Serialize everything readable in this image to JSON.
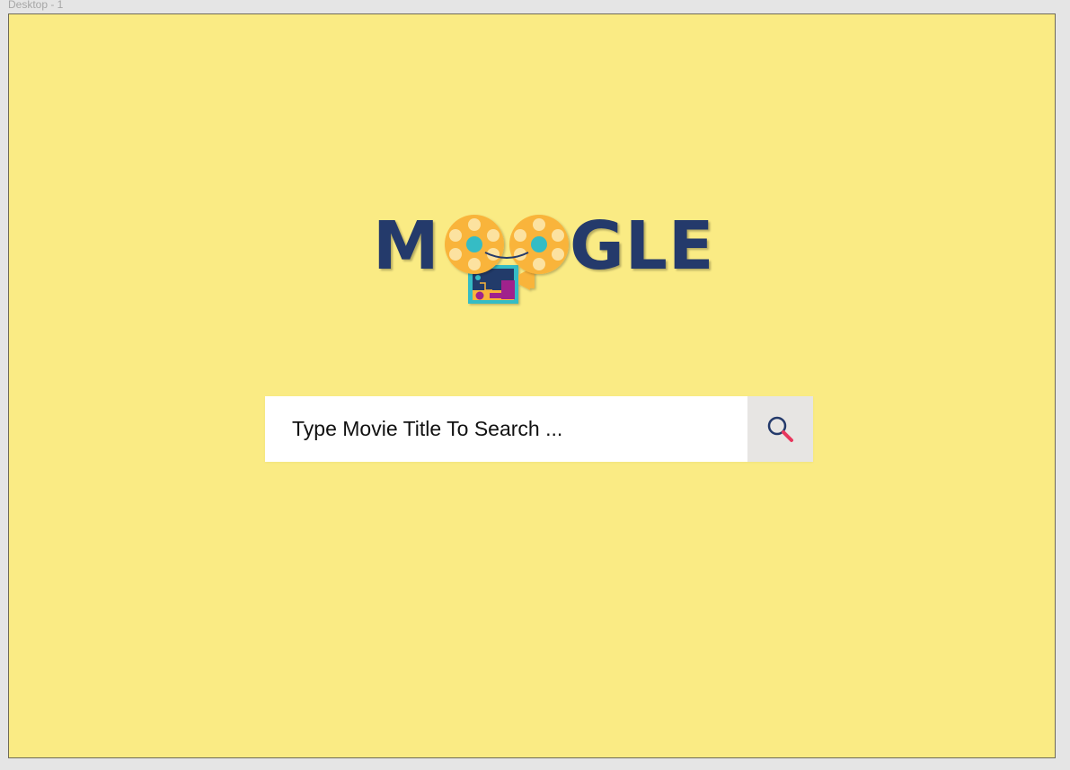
{
  "page": {
    "artboard_label": "Desktop - 1",
    "background_color": "#faeb84"
  },
  "logo": {
    "brand_name": "MOOGLE",
    "letter_m": "M",
    "letters_gle": "GLE",
    "text_color": "#243a6b",
    "reel_color": "#f9b43a",
    "accent_teal": "#35bcc5",
    "accent_purple": "#a0208c",
    "icon": "film-projector-icon"
  },
  "search": {
    "placeholder": "Type Movie Title To Search ...",
    "value": "",
    "button_icon": "search-icon",
    "button_background": "#e7e5e3"
  }
}
